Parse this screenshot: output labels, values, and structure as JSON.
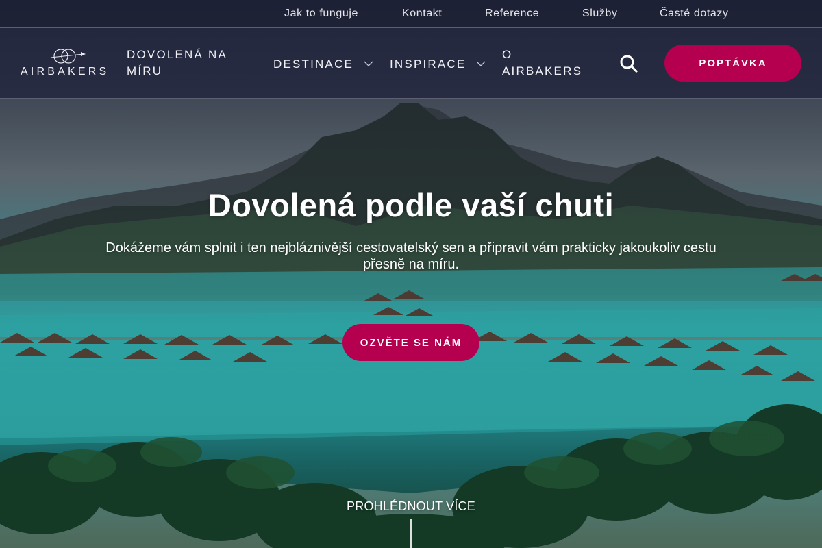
{
  "topbar": {
    "links": [
      {
        "label": "Jak to funguje"
      },
      {
        "label": "Kontakt"
      },
      {
        "label": "Reference"
      },
      {
        "label": "Služby"
      },
      {
        "label": "Časté dotazy"
      }
    ]
  },
  "header": {
    "logo_text": "AIRBAKERS",
    "nav": [
      {
        "label": "DOVOLENÁ NA MÍRU",
        "has_dropdown": false
      },
      {
        "label": "DESTINACE",
        "has_dropdown": true,
        "icon": "chevron-down-icon"
      },
      {
        "label": "INSPIRACE",
        "has_dropdown": true,
        "icon": "chevron-down-icon"
      },
      {
        "label": "O AIRBAKERS",
        "has_dropdown": false
      }
    ],
    "search_icon": "search-icon",
    "cta_label": "POPTÁVKA"
  },
  "hero": {
    "title": "Dovolená podle vaší chuti",
    "subtitle": "Dokážeme vám splnit i ten nejbláznivější cestovatelský sen a připravit vám prakticky jakoukoliv cestu přesně na míru.",
    "cta_label": "OZVĚTE SE NÁM",
    "scroll_label": "PROHLÉDNOUT VÍCE"
  },
  "colors": {
    "brand": "#b4004e",
    "header_bg": "#22263e",
    "text": "#ffffff"
  }
}
